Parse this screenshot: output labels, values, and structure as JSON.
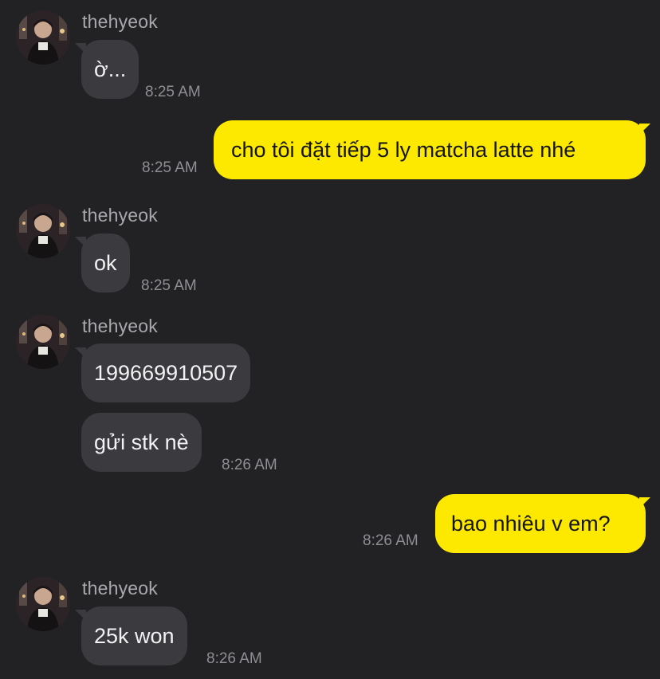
{
  "chat": {
    "sender_name": "thehyeok",
    "groups": [
      {
        "messages": [
          "ờ..."
        ],
        "time": "8:25 AM"
      },
      {
        "messages": [
          "ok"
        ],
        "time": "8:25 AM"
      },
      {
        "messages": [
          "199669910507",
          "gửi stk nè"
        ],
        "time": "8:26 AM"
      },
      {
        "messages": [
          "25k won"
        ],
        "time": "8:26 AM"
      }
    ],
    "outgoing": [
      {
        "text": "cho tôi đặt tiếp 5 ly matcha latte nhé",
        "time": "8:25 AM"
      },
      {
        "text": "bao nhiêu v em?",
        "time": "8:26 AM"
      }
    ]
  },
  "colors": {
    "background": "#222225",
    "incoming_bubble": "#3b3b3f",
    "outgoing_bubble": "#fde900",
    "timestamp": "#8e8e93"
  },
  "icons": {
    "avatar": "profile-photo"
  }
}
